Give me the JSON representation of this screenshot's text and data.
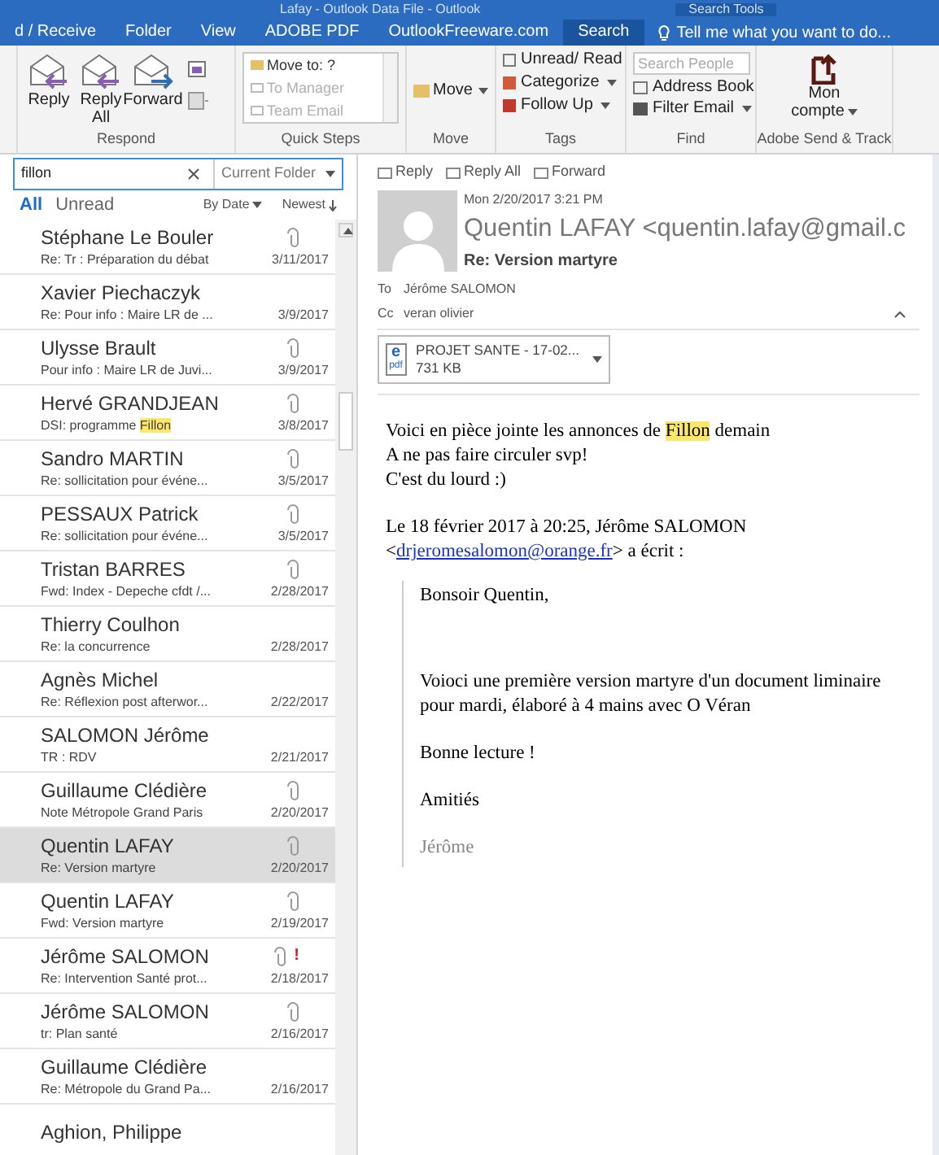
{
  "window": {
    "title": "Lafay - Outlook Data File - Outlook",
    "context_label": "Search Tools"
  },
  "tabs": [
    {
      "label": "d / Receive",
      "selected": false
    },
    {
      "label": "Folder",
      "selected": false
    },
    {
      "label": "View",
      "selected": false
    },
    {
      "label": "ADOBE PDF",
      "selected": false
    },
    {
      "label": "OutlookFreeware.com",
      "selected": false
    },
    {
      "label": "Search",
      "selected": true
    }
  ],
  "tell_me": "Tell me what you want to do...",
  "ribbon": {
    "respond": {
      "label": "Respond",
      "buttons": [
        "Reply",
        "Reply All",
        "Forward"
      ]
    },
    "quick_steps": {
      "label": "Quick Steps",
      "items": [
        {
          "label": "Move to: ?",
          "disabled": false
        },
        {
          "label": "To Manager",
          "disabled": true
        },
        {
          "label": "Team Email",
          "disabled": true
        }
      ]
    },
    "move": {
      "label": "Move",
      "button": "Move"
    },
    "tags": {
      "label": "Tags",
      "buttons": [
        "Unread/ Read",
        "Categorize",
        "Follow Up"
      ]
    },
    "find": {
      "label": "Find",
      "search_placeholder": "Search People",
      "buttons": [
        "Address Book",
        "Filter Email"
      ]
    },
    "adobe": {
      "label": "Adobe Send & Track",
      "button_line1": "Mon",
      "button_line2": "compte"
    }
  },
  "search": {
    "value": "fillon",
    "scope": "Current Folder"
  },
  "filters": [
    {
      "label": "All",
      "selected": true
    },
    {
      "label": "Unread",
      "selected": false
    }
  ],
  "sort": {
    "by": "By Date",
    "order": "Newest"
  },
  "messages": [
    {
      "sender": "Stéphane Le Bouler",
      "subject": [
        {
          "text": "Re: Tr : Préparation du débat",
          "highlighted": false
        }
      ],
      "date": "3/11/2017",
      "attachment": true,
      "important": false,
      "selected": false
    },
    {
      "sender": "Xavier Piechaczyk",
      "subject": [
        {
          "text": "Re: Pour info : Maire LR de ...",
          "highlighted": false
        }
      ],
      "date": "3/9/2017",
      "attachment": false,
      "important": false,
      "selected": false
    },
    {
      "sender": "Ulysse Brault",
      "subject": [
        {
          "text": "Pour info : Maire LR de Juvi...",
          "highlighted": false
        }
      ],
      "date": "3/9/2017",
      "attachment": true,
      "important": false,
      "selected": false
    },
    {
      "sender": "Hervé GRANDJEAN",
      "subject": [
        {
          "text": "DSI: programme ",
          "highlighted": false
        },
        {
          "text": "Fillon",
          "highlighted": true
        }
      ],
      "date": "3/8/2017",
      "attachment": true,
      "important": false,
      "selected": false
    },
    {
      "sender": "Sandro MARTIN",
      "subject": [
        {
          "text": "Re: sollicitation pour événe...",
          "highlighted": false
        }
      ],
      "date": "3/5/2017",
      "attachment": true,
      "important": false,
      "selected": false
    },
    {
      "sender": "PESSAUX Patrick",
      "subject": [
        {
          "text": "Re: sollicitation pour événe...",
          "highlighted": false
        }
      ],
      "date": "3/5/2017",
      "attachment": true,
      "important": false,
      "selected": false
    },
    {
      "sender": "Tristan BARRES",
      "subject": [
        {
          "text": "Fwd: Index - Depeche cfdt /...",
          "highlighted": false
        }
      ],
      "date": "2/28/2017",
      "attachment": true,
      "important": false,
      "selected": false
    },
    {
      "sender": "Thierry Coulhon",
      "subject": [
        {
          "text": "Re: la concurrence",
          "highlighted": false
        }
      ],
      "date": "2/28/2017",
      "attachment": false,
      "important": false,
      "selected": false
    },
    {
      "sender": "Agnès Michel",
      "subject": [
        {
          "text": "Re: Réflexion post afterwor...",
          "highlighted": false
        }
      ],
      "date": "2/22/2017",
      "attachment": false,
      "important": false,
      "selected": false
    },
    {
      "sender": "SALOMON Jérôme",
      "subject": [
        {
          "text": "TR : RDV",
          "highlighted": false
        }
      ],
      "date": "2/21/2017",
      "attachment": false,
      "important": false,
      "selected": false
    },
    {
      "sender": "Guillaume Clédière",
      "subject": [
        {
          "text": "Note Métropole Grand Paris",
          "highlighted": false
        }
      ],
      "date": "2/20/2017",
      "attachment": true,
      "important": false,
      "selected": false
    },
    {
      "sender": "Quentin LAFAY",
      "subject": [
        {
          "text": "Re: Version martyre",
          "highlighted": false
        }
      ],
      "date": "2/20/2017",
      "attachment": true,
      "important": false,
      "selected": true
    },
    {
      "sender": "Quentin LAFAY",
      "subject": [
        {
          "text": "Fwd: Version martyre",
          "highlighted": false
        }
      ],
      "date": "2/19/2017",
      "attachment": true,
      "important": false,
      "selected": false
    },
    {
      "sender": "Jérôme SALOMON",
      "subject": [
        {
          "text": "Re: Intervention Santé prot...",
          "highlighted": false
        }
      ],
      "date": "2/18/2017",
      "attachment": true,
      "important": true,
      "important_mark": "!",
      "selected": false
    },
    {
      "sender": "Jérôme SALOMON",
      "subject": [
        {
          "text": "tr: Plan santé",
          "highlighted": false
        }
      ],
      "date": "2/16/2017",
      "attachment": true,
      "important": false,
      "selected": false
    },
    {
      "sender": "Guillaume Clédière",
      "subject": [
        {
          "text": "Re: Métropole du Grand Pa...",
          "highlighted": false
        }
      ],
      "date": "2/16/2017",
      "attachment": false,
      "important": false,
      "selected": false
    },
    {
      "sender": "Aghion, Philippe",
      "attachment": false,
      "important": false,
      "selected": false
    }
  ],
  "reading": {
    "actions": [
      "Reply",
      "Reply All",
      "Forward"
    ],
    "date": "Mon 2/20/2017 3:21 PM",
    "from": "Quentin LAFAY <quentin.lafay@gmail.c",
    "subject": "Re: Version martyre",
    "to_label": "To",
    "to": "Jérôme SALOMON",
    "cc_label": "Cc",
    "cc": "veran olivier",
    "attachment": {
      "name": "PROJET SANTE - 17-02...",
      "size": "731 KB",
      "type_top": "e",
      "type_bottom": "pdf"
    },
    "body": [
      [
        {
          "text": "Voici en pièce jointe les annonces de ",
          "highlighted": false
        },
        {
          "text": "Fillon",
          "highlighted": true
        },
        {
          "text": " demain",
          "highlighted": false
        }
      ],
      [
        {
          "text": "A ne pas faire circuler svp!",
          "highlighted": false
        }
      ],
      [
        {
          "text": "C'est du lourd :)",
          "highlighted": false
        }
      ]
    ],
    "quote_header_line1": "Le 18 février 2017 à 20:25, Jérôme SALOMON",
    "quote_header_open": "<",
    "quote_link": "drjeromesalomon@orange.fr",
    "quote_header_close": "> a écrit :",
    "quote": [
      {
        "text": "Bonsoir Quentin,",
        "muted": false
      },
      {
        "text": "Voioci une première version martyre d'un document liminaire pour mardi, élaboré à 4 mains avec O Véran",
        "muted": false
      },
      {
        "text": "Bonne lecture !",
        "muted": false
      },
      {
        "text": "Amitiés",
        "muted": false
      },
      {
        "text": "Jérôme",
        "muted": true
      }
    ]
  }
}
